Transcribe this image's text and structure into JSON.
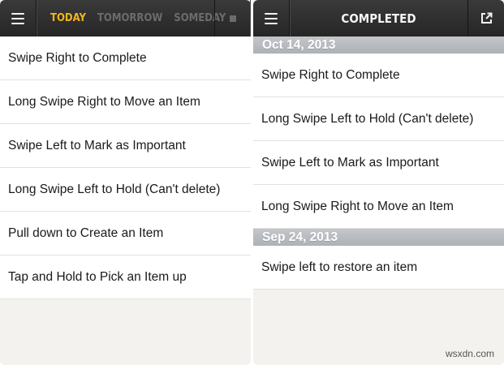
{
  "left_panel": {
    "tabs": [
      {
        "label": "TODAY",
        "active": true
      },
      {
        "label": "TOMORROW",
        "active": false
      },
      {
        "label": "SOMEDAY",
        "active": false
      }
    ],
    "items": [
      "Swipe Right to Complete",
      "Long Swipe Right to Move an Item",
      "Swipe Left to Mark as Important",
      "Long Swipe Left to Hold (Can't delete)",
      "Pull down to Create an Item",
      "Tap and Hold to Pick an Item up"
    ]
  },
  "right_panel": {
    "title": "COMPLETED",
    "groups": [
      {
        "date": "Oct 14, 2013",
        "items": [
          "Swipe Right to Complete",
          "Long Swipe Left to Hold (Can't delete)",
          "Swipe Left to Mark as Important",
          "Long Swipe Right to Move an Item"
        ]
      },
      {
        "date": "Sep 24, 2013",
        "items": [
          "Swipe left to restore an item"
        ]
      }
    ]
  },
  "watermark": "wsxdn.com",
  "colors": {
    "accent": "#f2b51e",
    "inactive_tab": "#6c6c6c",
    "topbar": "#2e2e2e",
    "date_header": "#b8bcc1",
    "background": "#f3f2ee"
  },
  "icons": {
    "menu": "hamburger-icon",
    "square": "square-icon",
    "export": "share-export-icon"
  }
}
